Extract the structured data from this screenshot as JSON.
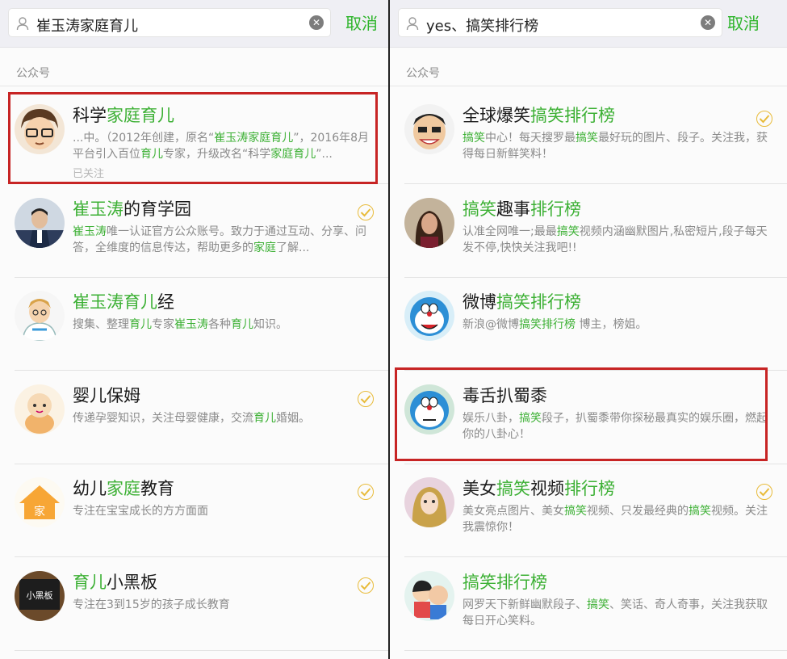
{
  "colors": {
    "accent_green": "#2db42a",
    "highlight_green": "#3cb034",
    "annotation_red": "#c72424",
    "followed_badge": "#e8bb3a"
  },
  "left": {
    "search": {
      "query": "崔玉涛家庭育儿",
      "cancel": "取消"
    },
    "section_label": "公众号",
    "items": [
      {
        "title": [
          {
            "t": "科学"
          },
          {
            "t": "家庭育儿",
            "hl": true
          }
        ],
        "desc": [
          {
            "t": "...中。（2012年创建，原名“"
          },
          {
            "t": "崔玉涛家庭育儿",
            "hl": true
          },
          {
            "t": "”，2016年8月平台引入百位"
          },
          {
            "t": "育儿",
            "hl": true
          },
          {
            "t": "专家，升级改名“科学"
          },
          {
            "t": "家庭育儿",
            "hl": true
          },
          {
            "t": "”..."
          }
        ],
        "followed": "已关注",
        "badge": false,
        "avatar": "cartoon-glasses-man"
      },
      {
        "title": [
          {
            "t": "崔玉涛",
            "hl": true
          },
          {
            "t": "的育学园"
          }
        ],
        "desc": [
          {
            "t": "崔玉涛",
            "hl": true
          },
          {
            "t": "唯一认证官方公众账号。致力于通过互动、分享、问答，全维度的信息传达，帮助更多的"
          },
          {
            "t": "家庭",
            "hl": true
          },
          {
            "t": "了解..."
          }
        ],
        "badge": true,
        "avatar": "photo-man-suit"
      },
      {
        "title": [
          {
            "t": "崔玉涛育儿",
            "hl": true
          },
          {
            "t": "经"
          }
        ],
        "desc": [
          {
            "t": "搜集、整理"
          },
          {
            "t": "育儿",
            "hl": true
          },
          {
            "t": "专家"
          },
          {
            "t": "崔玉涛",
            "hl": true
          },
          {
            "t": "各种"
          },
          {
            "t": "育儿",
            "hl": true
          },
          {
            "t": "知识。"
          }
        ],
        "badge": false,
        "avatar": "cartoon-doctor"
      },
      {
        "title": [
          {
            "t": "婴儿保姆"
          }
        ],
        "desc": [
          {
            "t": "传递孕婴知识，关注母婴健康，交流"
          },
          {
            "t": "育儿",
            "hl": true
          },
          {
            "t": "婚姻。"
          }
        ],
        "badge": true,
        "avatar": "cartoon-baby"
      },
      {
        "title": [
          {
            "t": "幼儿"
          },
          {
            "t": "家庭",
            "hl": true
          },
          {
            "t": "教育"
          }
        ],
        "desc": [
          {
            "t": "专注在宝宝成长的方方面面"
          }
        ],
        "badge": true,
        "avatar": "house-logo",
        "avatar_text": "家"
      },
      {
        "title": [
          {
            "t": "育儿",
            "hl": true
          },
          {
            "t": "小黑板"
          }
        ],
        "desc": [
          {
            "t": "专注在3到15岁的孩子成长教育"
          }
        ],
        "badge": true,
        "avatar": "blackboard-logo",
        "avatar_text": "小黑板"
      }
    ]
  },
  "right": {
    "search": {
      "query": "yes、搞笑排行榜",
      "cancel": "取消"
    },
    "section_label": "公众号",
    "items": [
      {
        "title": [
          {
            "t": "全球爆笑"
          },
          {
            "t": "搞笑排行榜",
            "hl": true
          }
        ],
        "desc": [
          {
            "t": "搞笑",
            "hl": true
          },
          {
            "t": "中心！每天搜罗最"
          },
          {
            "t": "搞笑",
            "hl": true
          },
          {
            "t": "最好玩的图片、段子。关注我，获得每日新鲜笑料！"
          }
        ],
        "badge": true,
        "avatar": "caricature-face"
      },
      {
        "title": [
          {
            "t": "搞笑",
            "hl": true
          },
          {
            "t": "趣事"
          },
          {
            "t": "排行榜",
            "hl": true
          }
        ],
        "desc": [
          {
            "t": "认准全网唯一;最最"
          },
          {
            "t": "搞笑",
            "hl": true
          },
          {
            "t": "视频内涵幽默图片,私密短片,段子每天发不停,快快关注我吧!!"
          }
        ],
        "badge": false,
        "avatar": "photo-woman"
      },
      {
        "title": [
          {
            "t": "微博"
          },
          {
            "t": "搞笑排行榜",
            "hl": true
          }
        ],
        "desc": [
          {
            "t": "新浪@微博"
          },
          {
            "t": "搞笑排行榜",
            "hl": true
          },
          {
            "t": " 博主，榜姐。"
          }
        ],
        "badge": false,
        "avatar": "doraemon"
      },
      {
        "title": [
          {
            "t": "毒舌扒蜀黍"
          }
        ],
        "desc": [
          {
            "t": "娱乐八卦，"
          },
          {
            "t": "搞笑",
            "hl": true
          },
          {
            "t": "段子，扒蜀黍带你探秘最真实的娱乐圈，燃起你的八卦心！"
          }
        ],
        "badge": false,
        "avatar": "doraemon-2"
      },
      {
        "title": [
          {
            "t": "美女"
          },
          {
            "t": "搞笑",
            "hl": true
          },
          {
            "t": "视频"
          },
          {
            "t": "排行榜",
            "hl": true
          }
        ],
        "desc": [
          {
            "t": "美女亮点图片、美女"
          },
          {
            "t": "搞笑",
            "hl": true
          },
          {
            "t": "视频、只发最经典的"
          },
          {
            "t": "搞笑",
            "hl": true
          },
          {
            "t": "视频。关注我震惊你！"
          }
        ],
        "badge": true,
        "avatar": "photo-girl"
      },
      {
        "title": [
          {
            "t": "搞笑排行榜",
            "hl": true
          }
        ],
        "desc": [
          {
            "t": "网罗天下新鲜幽默段子、"
          },
          {
            "t": "搞笑",
            "hl": true
          },
          {
            "t": "、笑话、奇人奇事，关注我获取每日开心笑料。"
          }
        ],
        "badge": false,
        "avatar": "cartoon-kids"
      }
    ]
  }
}
